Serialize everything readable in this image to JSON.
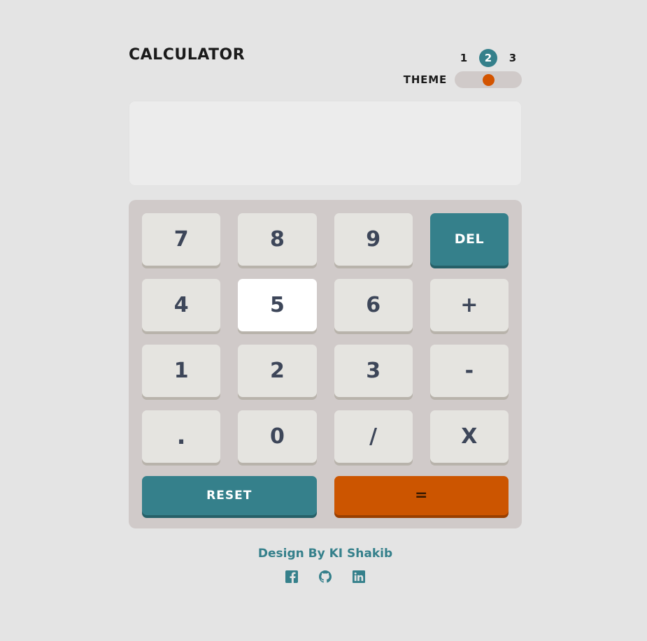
{
  "header": {
    "title": "CALCULATOR",
    "theme_label": "THEME",
    "theme_options": [
      "1",
      "2",
      "3"
    ],
    "theme_selected": "2",
    "knob_color": "#d35400",
    "active_color": "#35808b"
  },
  "display": {
    "value": "",
    "placeholder": ""
  },
  "keypad": {
    "keys": [
      {
        "label": "7",
        "kind": "digit",
        "state": "normal"
      },
      {
        "label": "8",
        "kind": "digit",
        "state": "normal"
      },
      {
        "label": "9",
        "kind": "digit",
        "state": "normal"
      },
      {
        "label": "DEL",
        "kind": "accent",
        "state": "normal"
      },
      {
        "label": "4",
        "kind": "digit",
        "state": "normal"
      },
      {
        "label": "5",
        "kind": "digit",
        "state": "hover"
      },
      {
        "label": "6",
        "kind": "digit",
        "state": "normal"
      },
      {
        "label": "+",
        "kind": "operator",
        "state": "normal"
      },
      {
        "label": "1",
        "kind": "digit",
        "state": "normal"
      },
      {
        "label": "2",
        "kind": "digit",
        "state": "normal"
      },
      {
        "label": "3",
        "kind": "digit",
        "state": "normal"
      },
      {
        "label": "-",
        "kind": "operator",
        "state": "normal"
      },
      {
        "label": ".",
        "kind": "dot",
        "state": "normal"
      },
      {
        "label": "0",
        "kind": "digit",
        "state": "normal"
      },
      {
        "label": "/",
        "kind": "operator",
        "state": "normal"
      },
      {
        "label": "X",
        "kind": "operator",
        "state": "normal"
      }
    ],
    "reset_label": "RESET",
    "equals_label": "=",
    "panel_color": "#d0cac9",
    "key_color": "#e5e4e0",
    "key_text_color": "#3d4659",
    "accent_color": "#35808b",
    "equals_color": "#cc5500"
  },
  "footer": {
    "credit": "Design By KI Shakib",
    "socials": [
      {
        "name": "facebook-icon"
      },
      {
        "name": "github-icon"
      },
      {
        "name": "linkedin-icon"
      }
    ]
  }
}
